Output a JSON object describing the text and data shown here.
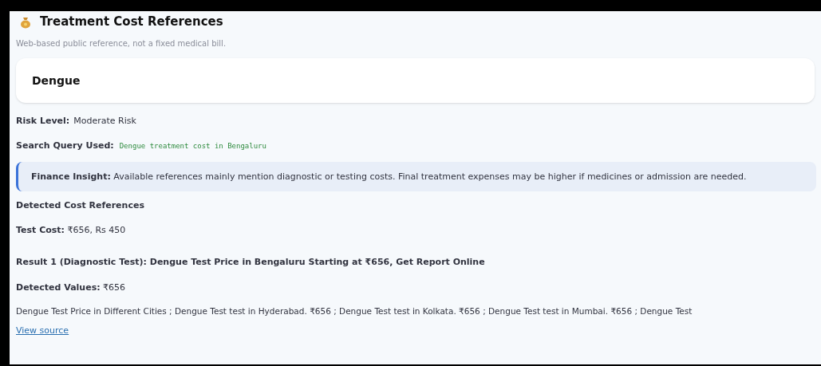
{
  "title": "Treatment Cost References",
  "subtitle": "Web-based public reference, not a fixed medical bill.",
  "disease": "Dengue",
  "fields": [
    {
      "label": "Risk Level:",
      "value": "Moderate Risk",
      "kind": "text"
    },
    {
      "label": "Search Query Used:",
      "value": "Dengue treatment cost in Bengaluru",
      "kind": "code"
    }
  ],
  "insight": {
    "label": "Finance Insight:",
    "text": "Available references mainly mention diagnostic or testing costs. Final treatment expenses may be higher if medicines or admission are needed."
  },
  "section_heading": "Detected Cost References",
  "test_cost": {
    "label": "Test Cost:",
    "value": "₹656, Rs 450"
  },
  "results": [
    {
      "heading": "Result 1 (Diagnostic Test): Dengue Test Price in Bengaluru Starting at ₹656, Get Report Online",
      "detected_label": "Detected Values:",
      "detected_value": "₹656",
      "snippet": "Dengue Test Price in Different Cities ; Dengue Test test in Hyderabad. ₹656 ; Dengue Test test in Kolkata. ₹656 ; Dengue Test test in Mumbai. ₹656 ; Dengue Test",
      "link": "View source"
    }
  ]
}
